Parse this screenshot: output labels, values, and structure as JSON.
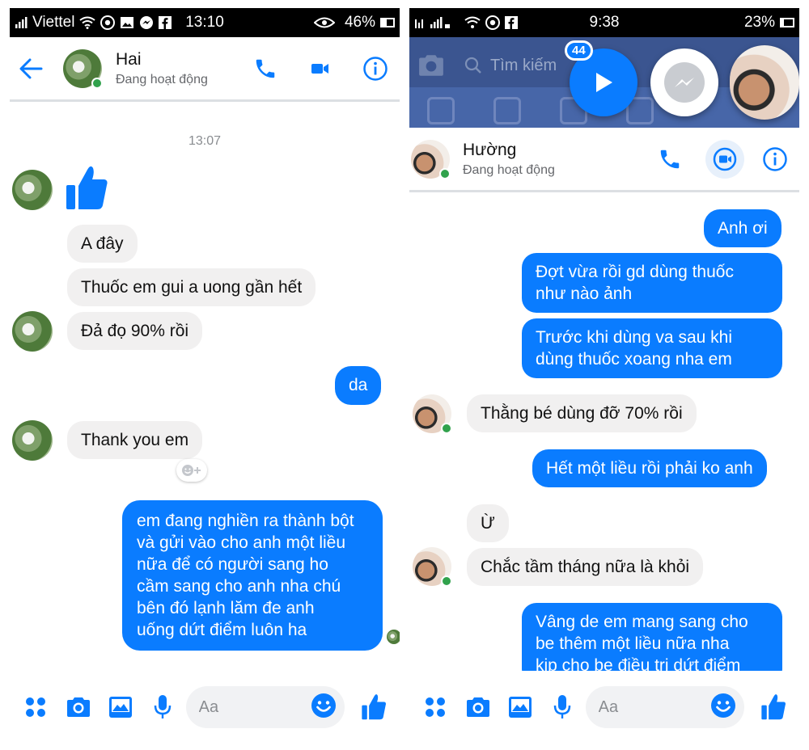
{
  "left": {
    "status": {
      "carrier": "Viettel",
      "time": "13:10",
      "battery": "46%",
      "battery_level": 0.46
    },
    "header": {
      "name": "Hai",
      "status": "Đang hoạt động"
    },
    "time_label": "13:07",
    "messages": {
      "a_day": "A đây",
      "thuoc": "Thuốc em gui a uong gần hết",
      "da_do": "Đả đọ 90% rồi",
      "da": "da",
      "thank_you": "Thank you em",
      "long": "em đang nghiền ra thành bột\nvà gửi vào cho anh một liều\nnữa để có người sang ho\ncầm sang cho anh nha chú\nbên đó lạnh lăm đe anh\nuống dứt điểm luôn ha"
    },
    "composer": {
      "placeholder": "Aa"
    }
  },
  "right": {
    "status": {
      "time": "9:38",
      "battery": "23%",
      "battery_level": 0.23
    },
    "fb": {
      "search_placeholder": "Tìm kiếm",
      "badge": "44"
    },
    "header": {
      "name": "Hường",
      "status": "Đang hoạt động"
    },
    "messages": {
      "anh_oi": "Anh ơi",
      "dot_vua": "Đợt vừa rồi gd dùng thuốc\nnhư nào ảnh",
      "truoc_khi": "Trước khi dùng va sau khi\ndùng thuốc xoang nha em",
      "thang_be": "Thằng bé dùng đỡ 70% rồi",
      "het_mot": "Hết một liều rồi phải ko anh",
      "u": "Ừ",
      "chac_tam": "Chắc tầm tháng nữa là khỏi",
      "vang_de": "Vâng de em mang sang cho\nbe thêm một liều nữa nha\nkịp cho be điều tri dứt điểm"
    },
    "composer": {
      "placeholder": "Aa"
    }
  },
  "colors": {
    "messenger_blue": "#0a7cff",
    "incoming_bubble": "#f1f0f0",
    "online_green": "#31a24c",
    "facebook_blue": "#3b5590"
  },
  "icons": [
    "back-arrow-icon",
    "phone-icon",
    "video-camera-icon",
    "info-icon",
    "thumbs-up-icon",
    "reaction-add-icon",
    "apps-grid-icon",
    "camera-icon",
    "gallery-icon",
    "microphone-icon",
    "emoji-icon",
    "play-icon",
    "messenger-icon",
    "search-icon"
  ]
}
